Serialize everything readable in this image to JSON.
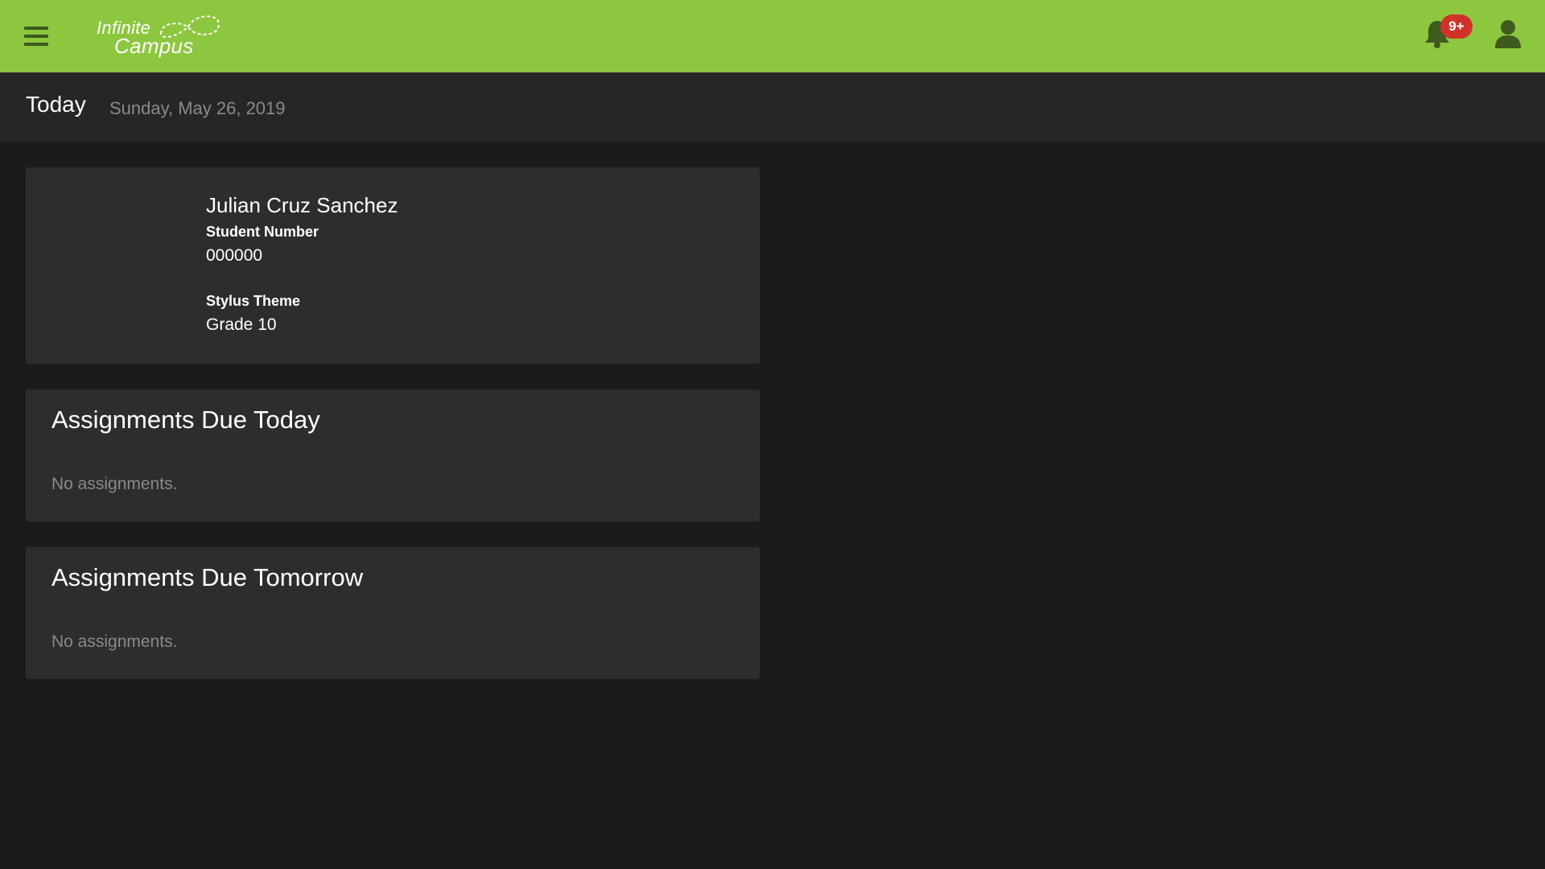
{
  "colors": {
    "topbar": "#8dc63f",
    "background": "#1b1b1b",
    "card": "#2d2d2d",
    "badge": "#d0322a"
  },
  "header": {
    "logo_line1": "Infinite",
    "logo_line2": "Campus",
    "notification_badge": "9+",
    "icons": [
      "menu-icon",
      "bell-icon",
      "user-icon"
    ]
  },
  "page": {
    "title": "Today",
    "date": "Sunday, May 26, 2019"
  },
  "student": {
    "name": "Julian Cruz Sanchez",
    "number_label": "Student Number",
    "number_value": "000000",
    "theme_label": "Stylus Theme",
    "theme_value": "Grade 10"
  },
  "due_today": {
    "title": "Assignments Due Today",
    "empty_text": "No assignments."
  },
  "due_tomorrow": {
    "title": "Assignments Due Tomorrow",
    "empty_text": "No assignments."
  }
}
